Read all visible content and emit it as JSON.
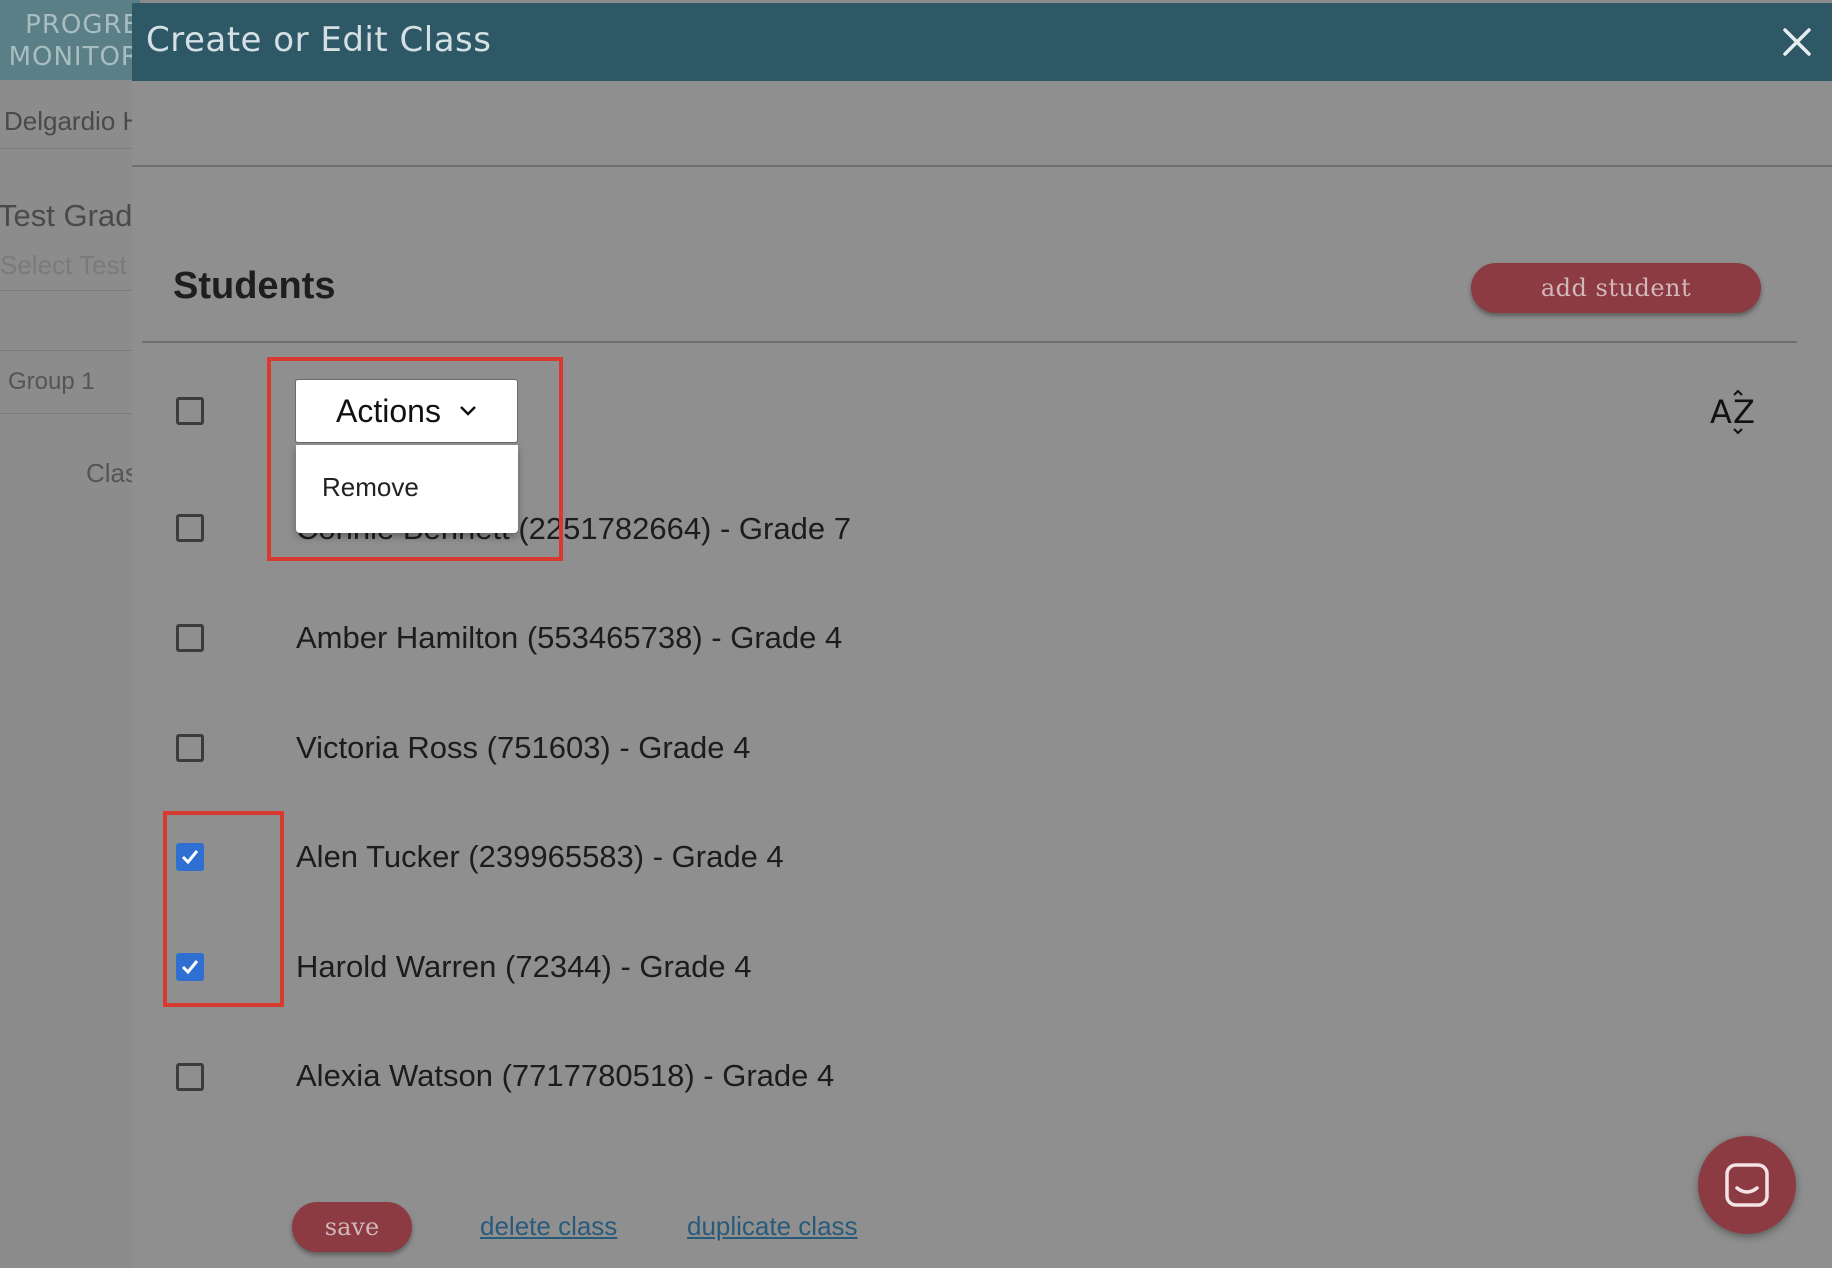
{
  "background": {
    "logo_line1": "PROGRE",
    "logo_line2": "MONITOR",
    "district": "Delgardio H",
    "test_label": "Test Grade",
    "test_select_placeholder": "Select Test",
    "group": "Group 1",
    "class_label": "Clas"
  },
  "modal": {
    "title": "Create or Edit Class",
    "close_icon": "close-icon"
  },
  "students": {
    "heading": "Students",
    "add_button": "add student",
    "actions_label": "Actions",
    "actions_menu": [
      "Remove"
    ],
    "sort_icon": "sort-az-icon",
    "list": [
      {
        "name": "Connie Bennett (2251782664) - Grade 7",
        "checked": false
      },
      {
        "name": "Amber Hamilton (553465738) - Grade 4",
        "checked": false
      },
      {
        "name": "Victoria Ross (751603) - Grade 4",
        "checked": false
      },
      {
        "name": "Alen Tucker (239965583) - Grade 4",
        "checked": true
      },
      {
        "name": "Harold Warren (72344) - Grade 4",
        "checked": true
      },
      {
        "name": "Alexia Watson (7717780518) - Grade 4",
        "checked": false
      }
    ]
  },
  "footer": {
    "save": "save",
    "delete": "delete class",
    "duplicate": "duplicate class"
  },
  "colors": {
    "header": "#2f5867",
    "primary_button": "#8c3b43",
    "checkbox_checked": "#2f6fd1",
    "highlight": "#d93a2f"
  }
}
